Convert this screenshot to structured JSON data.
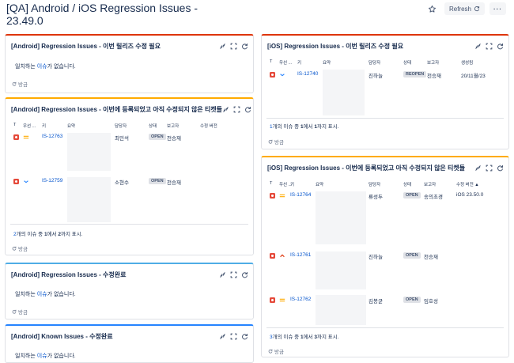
{
  "page": {
    "title": "[QA] Android / iOS Regression Issues - 23.49.0",
    "refresh_label": "Refresh",
    "more_label": "···"
  },
  "common": {
    "no_match_prefix": "일치하는 ",
    "no_match_link": "이슈",
    "no_match_suffix": "가 없습니다.",
    "refresh_label": "방금",
    "col_t": "T",
    "col_priority": "우선 ...",
    "col_key": "키",
    "col_summary": "요약",
    "col_assignee": "담당자",
    "col_status": "상태",
    "col_reporter": "보고자",
    "col_fixversion": "수정 버전",
    "col_created": "생성됨"
  },
  "gadgets": {
    "and_fix_needed": {
      "title": "[Android] Regression Issues - 이번 릴리즈 수정 필요"
    },
    "and_unfixed": {
      "title": "[Android] Regression Issues - 이번에 등록되었고 아직 수정되지 않은 티켓들",
      "rows": [
        {
          "priority": "medium",
          "key": "IS-12763",
          "assignee": "최민석",
          "status": "OPEN",
          "reporter": "천승재",
          "fixversion": ""
        },
        {
          "priority": "low",
          "key": "IS-12759",
          "assignee": "소현수",
          "status": "OPEN",
          "reporter": "천승재",
          "fixversion": ""
        }
      ],
      "footer_count": "2",
      "footer_mid1": "개의 이슈 중 ",
      "footer_from": "1",
      "footer_mid2": "에서 ",
      "footer_to": "2",
      "footer_end": "까지 표시."
    },
    "and_done": {
      "title": "[Android] Regression Issues - 수정완료"
    },
    "and_known": {
      "title": "[Android] Known Issues - 수정완료"
    },
    "ios_fix_needed": {
      "title": "[iOS] Regression Issues - 이번 릴리즈 수정 필요",
      "rows": [
        {
          "priority": "low",
          "key": "IS-12740",
          "assignee": "진하늘",
          "status": "REOPEN",
          "reporter": "천승재",
          "created": "20/11월/23"
        }
      ],
      "footer_count": "1",
      "footer_mid1": "개의 이슈 중 ",
      "footer_from": "1",
      "footer_mid2": "에서 ",
      "footer_to": "1",
      "footer_end": "까지 표시."
    },
    "ios_unfixed": {
      "title": "[iOS] Regression Issues - 이번에 등록되었고 아직 수정되지 않은 티켓들",
      "fixversion_header": "수정 버전 ▲",
      "rows": [
        {
          "priority": "medium",
          "key": "IS-12764",
          "assignee": "류성두",
          "status": "OPEN",
          "reporter": "송의초경",
          "fixversion": "iOS 23.50.0"
        },
        {
          "priority": "high",
          "key": "IS-12761",
          "assignee": "진하늘",
          "status": "OPEN",
          "reporter": "천승재",
          "fixversion": ""
        },
        {
          "priority": "medium",
          "key": "IS-12762",
          "assignee": "김봉균",
          "status": "OPEN",
          "reporter": "임호성",
          "fixversion": ""
        }
      ],
      "footer_count": "3",
      "footer_mid1": "개의 이슈 중 ",
      "footer_from": "1",
      "footer_mid2": "에서 ",
      "footer_to": "3",
      "footer_end": "까지 표시."
    }
  },
  "colors": {
    "priority_medium": "#ffab00",
    "priority_low": "#2684ff",
    "priority_high": "#de350b",
    "bug": "#e5493a",
    "link": "#0052cc"
  }
}
